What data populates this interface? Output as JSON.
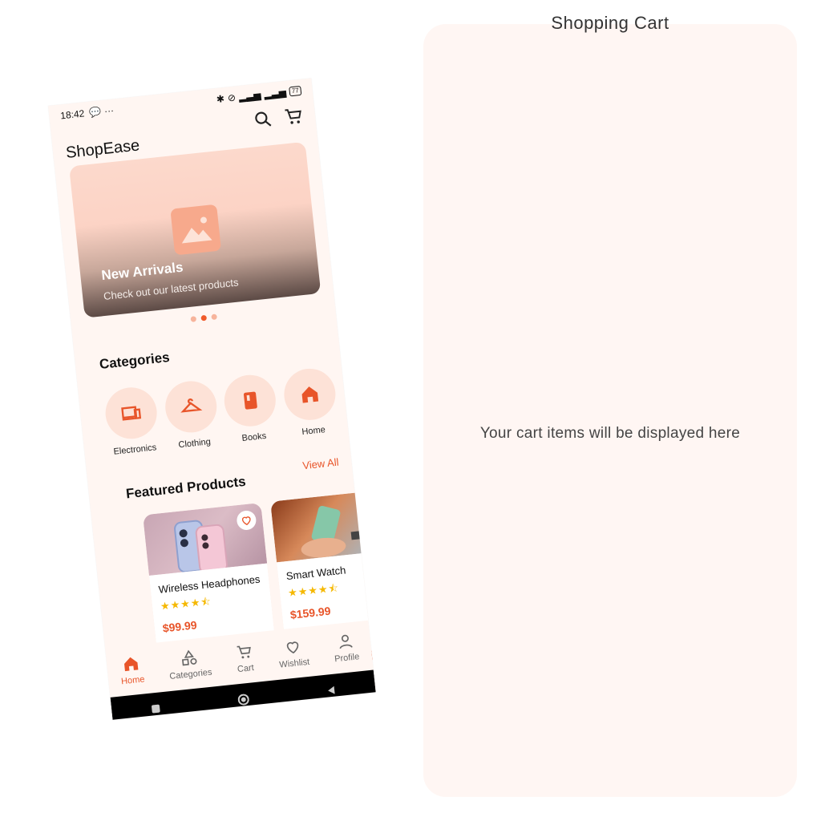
{
  "right_panel": {
    "title": "Shopping Cart",
    "placeholder": "Your cart items will be displayed here"
  },
  "status_bar": {
    "time": "18:42",
    "battery": "77"
  },
  "app": {
    "title": "ShopEase"
  },
  "banner": {
    "title": "New Arrivals",
    "subtitle": "Check out our latest products"
  },
  "categories": {
    "title": "Categories",
    "items": [
      {
        "label": "Electronics",
        "icon": "devices-icon"
      },
      {
        "label": "Clothing",
        "icon": "hanger-icon"
      },
      {
        "label": "Books",
        "icon": "book-icon"
      },
      {
        "label": "Home",
        "icon": "home-icon"
      }
    ]
  },
  "featured": {
    "title": "Featured Products",
    "view_all": "View All",
    "products": [
      {
        "name": "Wireless Headphones",
        "rating": 4.5,
        "stars": "★★★★⯪",
        "price": "$99.99"
      },
      {
        "name": "Smart Watch",
        "rating": 4.5,
        "stars": "★★★★⯪",
        "price": "$159.99"
      }
    ]
  },
  "bottom_nav": {
    "items": [
      {
        "label": "Home",
        "icon": "home-icon",
        "active": true
      },
      {
        "label": "Categories",
        "icon": "categories-icon",
        "active": false
      },
      {
        "label": "Cart",
        "icon": "cart-icon",
        "active": false
      },
      {
        "label": "Wishlist",
        "icon": "heart-icon",
        "active": false
      },
      {
        "label": "Profile",
        "icon": "person-icon",
        "active": false
      }
    ]
  },
  "colors": {
    "accent": "#e8552a",
    "background": "#fff6f2",
    "star": "#f5b800"
  }
}
